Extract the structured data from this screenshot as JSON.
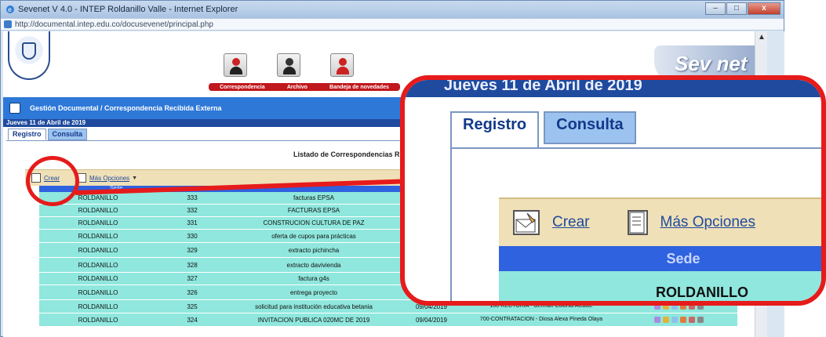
{
  "window": {
    "title": "Sevenet V 4.0 - INTEP Roldanillo Valle - Internet Explorer",
    "url": "http://documental.intep.edu.co/docusevenet/principal.php",
    "controls": [
      "–",
      "□",
      "x"
    ]
  },
  "header": {
    "logo_text": "Sev net",
    "modules": [
      {
        "label": "Correspondencia"
      },
      {
        "label": "Archivo"
      },
      {
        "label": "Bandeja de novedades"
      }
    ]
  },
  "breadcrumb": "Gestión Documental / Correspondencia Recibida Externa",
  "date": "Jueves 11 de Abril de 2019",
  "tabs": [
    {
      "label": "Registro",
      "active": true
    },
    {
      "label": "Consulta",
      "active": false
    }
  ],
  "listing_title": "Listado de Correspondencias R",
  "toolbar": {
    "create_label": "Crear",
    "more_label": "Más Opciones",
    "caret": "▼"
  },
  "table": {
    "header_sede": "Sede",
    "rows": [
      {
        "sede": "ROLDANILLO",
        "num": "333",
        "asunto": "facturas EPSA",
        "fecha": "",
        "dest": ""
      },
      {
        "sede": "ROLDANILLO",
        "num": "332",
        "asunto": "FACTURAS EPSA",
        "fecha": "",
        "dest": ""
      },
      {
        "sede": "ROLDANILLO",
        "num": "331",
        "asunto": "CONSTRUCION CULTURA DE PAZ",
        "fecha": "",
        "dest": ""
      },
      {
        "sede": "ROLDANILLO",
        "num": "330",
        "asunto": "oferta de cupos para prácticas",
        "fecha": "",
        "dest": ""
      },
      {
        "sede": "ROLDANILLO",
        "num": "329",
        "asunto": "extracto pichincha",
        "fecha": "",
        "dest": ""
      },
      {
        "sede": "ROLDANILLO",
        "num": "328",
        "asunto": "extracto davivienda",
        "fecha": "",
        "dest": ""
      },
      {
        "sede": "ROLDANILLO",
        "num": "327",
        "asunto": "factura g4s",
        "fecha": "10/",
        "dest": ""
      },
      {
        "sede": "ROLDANILLO",
        "num": "326",
        "asunto": "entrega proyecto",
        "fecha": "09/04/2019",
        "dest": "PROYECCION SOCIAL - ..."
      },
      {
        "sede": "ROLDANILLO",
        "num": "325",
        "asunto": "solicitud para institución educativa betania",
        "fecha": "09/04/2019",
        "dest": "100-RECTORIA - German Colonia Alcalde"
      },
      {
        "sede": "ROLDANILLO",
        "num": "324",
        "asunto": "INVITACION PUBLICA 020MC DE 2019",
        "fecha": "09/04/2019",
        "dest": "700-CONTRATACION - Diosa Alexa Pineda Olaya"
      }
    ]
  },
  "zoom": {
    "date": "Jueves 11 de Abril de 2019",
    "tab_registro": "Registro",
    "tab_consulta": "Consulta",
    "create_label": "Crear",
    "more_label": "Más Opciones",
    "sede_header": "Sede",
    "first_row_sede": "ROLDANILLO"
  },
  "colors": {
    "highlight_red": "#e61b1b",
    "row_teal": "#8fe7dd",
    "header_blue": "#2e78d8",
    "toolbar_tan": "#efe0b7"
  }
}
